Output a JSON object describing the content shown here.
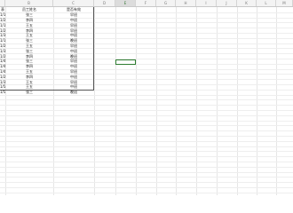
{
  "columns": [
    "B",
    "C",
    "D",
    "E",
    "F",
    "G",
    "H",
    "I",
    "J",
    "K",
    "L",
    "M"
  ],
  "active_column": "E",
  "header_row": [
    "表",
    "员工姓名",
    "是否有效"
  ],
  "rows": [
    [
      "1/1",
      "张三",
      "早班"
    ],
    [
      "1/2",
      "李四",
      "中班"
    ],
    [
      "1/1",
      "王五",
      "早班"
    ],
    [
      "1/2",
      "李四",
      "早班"
    ],
    [
      "1/3",
      "王五",
      "中班"
    ],
    [
      "1/1",
      "张三",
      "晚班"
    ],
    [
      "1/2",
      "王五",
      "早班"
    ],
    [
      "1/3",
      "张三",
      "中班"
    ],
    [
      "1/2",
      "李四",
      "晚班"
    ],
    [
      "1/4",
      "张三",
      "早班"
    ],
    [
      "1/4",
      "李四",
      "中班"
    ],
    [
      "1/4",
      "王五",
      "早班"
    ],
    [
      "1/2",
      "李四",
      "中班"
    ],
    [
      "1/3",
      "王五",
      "早班"
    ],
    [
      "1/5",
      "王五",
      "中班"
    ],
    [
      "1/5",
      "张三",
      "晚班"
    ]
  ],
  "colors": {
    "grid": "#e6e6e6",
    "header_bg": "#f3f3f3",
    "selection": "#2f7d32"
  }
}
